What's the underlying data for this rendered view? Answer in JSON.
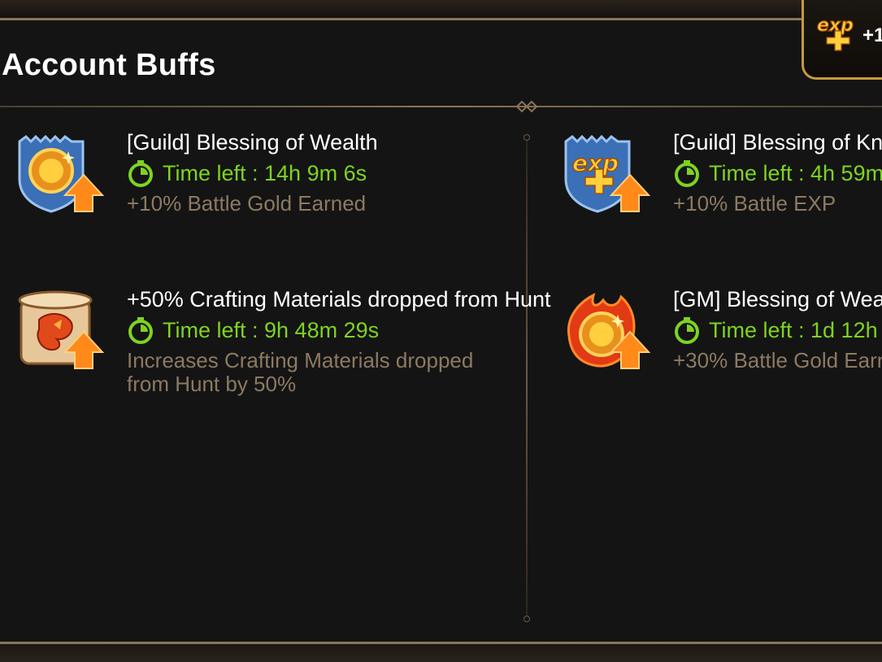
{
  "panel": {
    "title": "Account Buffs",
    "exp_badge_text": "+1",
    "exp_badge_icon": "exp-plus-icon"
  },
  "colors": {
    "accent_gold": "#8a7656",
    "time_green": "#7ed321",
    "desc_brown": "#8c7a62",
    "title_white": "#ffffff"
  },
  "buffs": [
    {
      "icon": "guild-gold-shield-icon",
      "title": "[Guild] Blessing of Wealth",
      "time_left": "Time left : 14h 9m 6s",
      "description": "+10% Battle Gold Earned"
    },
    {
      "icon": "guild-exp-shield-icon",
      "title": "[Guild] Blessing of Kn",
      "time_left": "Time left : 4h 59m",
      "description": "+10% Battle EXP"
    },
    {
      "icon": "crafting-scroll-icon",
      "title": "+50% Crafting Materials dropped from Hunt",
      "time_left": "Time left : 9h 48m 29s",
      "description": "Increases Crafting Materials dropped from Hunt by 50%"
    },
    {
      "icon": "gm-flaming-coin-icon",
      "title": "[GM] Blessing of Wea",
      "time_left": "Time left : 1d 12h",
      "description": "+30% Battle Gold Earn"
    }
  ]
}
